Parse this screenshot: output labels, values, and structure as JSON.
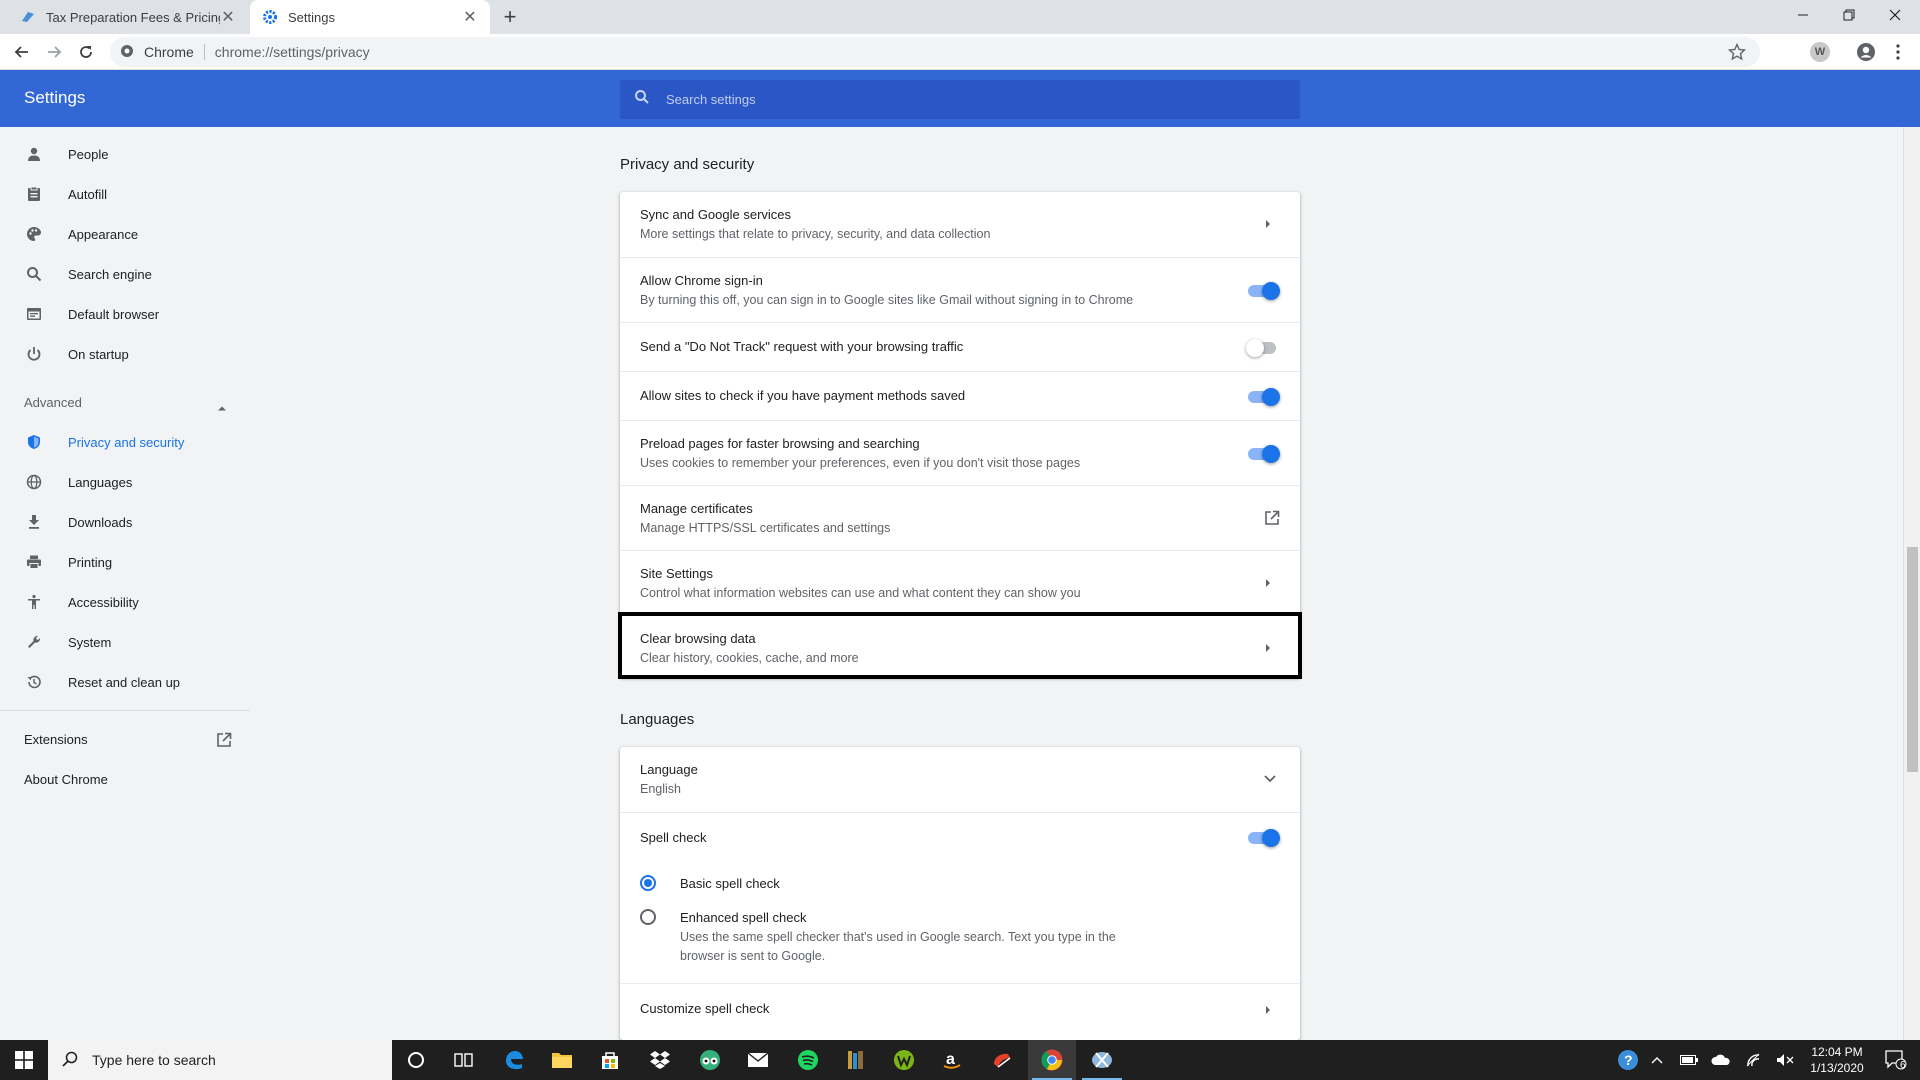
{
  "browser": {
    "tabs": [
      {
        "title": "Tax Preparation Fees & Pricing Op"
      },
      {
        "title": "Settings"
      }
    ],
    "omnibox": {
      "site": "Chrome",
      "url": "chrome://settings/privacy"
    },
    "profile_badge": "W"
  },
  "settings": {
    "title": "Settings",
    "search_placeholder": "Search settings"
  },
  "sidebar": {
    "items": [
      {
        "label": "People",
        "icon": "person-icon"
      },
      {
        "label": "Autofill",
        "icon": "clipboard-icon"
      },
      {
        "label": "Appearance",
        "icon": "palette-icon"
      },
      {
        "label": "Search engine",
        "icon": "search-icon"
      },
      {
        "label": "Default browser",
        "icon": "browser-icon"
      },
      {
        "label": "On startup",
        "icon": "power-icon"
      }
    ],
    "advanced_label": "Advanced",
    "advanced_items": [
      {
        "label": "Privacy and security",
        "icon": "shield-icon",
        "selected": true
      },
      {
        "label": "Languages",
        "icon": "globe-icon"
      },
      {
        "label": "Downloads",
        "icon": "download-icon"
      },
      {
        "label": "Printing",
        "icon": "printer-icon"
      },
      {
        "label": "Accessibility",
        "icon": "accessibility-icon"
      },
      {
        "label": "System",
        "icon": "wrench-icon"
      },
      {
        "label": "Reset and clean up",
        "icon": "history-icon"
      }
    ],
    "extensions_label": "Extensions",
    "about_label": "About Chrome"
  },
  "privacy": {
    "section_title": "Privacy and security",
    "rows": [
      {
        "title": "Sync and Google services",
        "subtitle": "More settings that relate to privacy, security, and data collection",
        "control": "arrow"
      },
      {
        "title": "Allow Chrome sign-in",
        "subtitle": "By turning this off, you can sign in to Google sites like Gmail without signing in to Chrome",
        "control": "toggle",
        "on": true
      },
      {
        "title": "Send a \"Do Not Track\" request with your browsing traffic",
        "control": "toggle",
        "on": false
      },
      {
        "title": "Allow sites to check if you have payment methods saved",
        "control": "toggle",
        "on": true
      },
      {
        "title": "Preload pages for faster browsing and searching",
        "subtitle": "Uses cookies to remember your preferences, even if you don't visit those pages",
        "control": "toggle",
        "on": true
      },
      {
        "title": "Manage certificates",
        "subtitle": "Manage HTTPS/SSL certificates and settings",
        "control": "external"
      },
      {
        "title": "Site Settings",
        "subtitle": "Control what information websites can use and what content they can show you",
        "control": "arrow",
        "highlighted": true
      },
      {
        "title": "Clear browsing data",
        "subtitle": "Clear history, cookies, cache, and more",
        "control": "arrow"
      }
    ]
  },
  "languages": {
    "section_title": "Languages",
    "language_label": "Language",
    "language_value": "English",
    "spell_check_label": "Spell check",
    "spell_check_on": true,
    "basic_label": "Basic spell check",
    "enhanced_label": "Enhanced spell check",
    "enhanced_desc": "Uses the same spell checker that's used in Google search. Text you type in the browser is sent to Google.",
    "selected_mode": "basic",
    "customize_label": "Customize spell check"
  },
  "taskbar": {
    "search_placeholder": "Type here to search",
    "time": "12:04 PM",
    "date": "1/13/2020",
    "notification_count": "6",
    "apps": [
      "cortana-icon",
      "task-view-icon",
      "edge-icon",
      "file-explorer-icon",
      "store-icon",
      "dropbox-icon",
      "tripadvisor-icon",
      "mail-icon",
      "spotify-icon",
      "books-icon",
      "wordament-icon",
      "amazon-icon",
      "paint-icon",
      "chrome-icon",
      "snip-icon"
    ]
  },
  "colors": {
    "header_blue": "#3367d6",
    "accent": "#1a73e8",
    "highlight_border": "#000000"
  }
}
